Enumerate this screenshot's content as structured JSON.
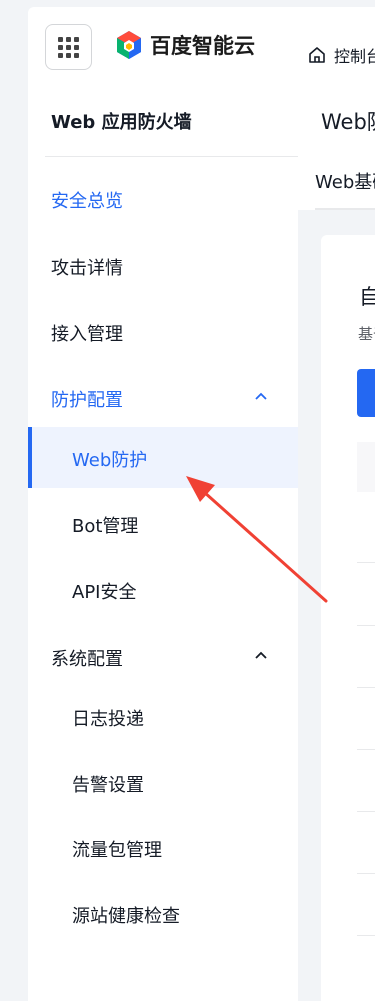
{
  "header": {
    "menu_icon": "grid-icon",
    "brand": "百度智能云",
    "console_label": "控制台",
    "home_icon": "home-icon"
  },
  "sidebar": {
    "title": "Web 应用防火墙",
    "items": [
      {
        "label": "安全总览",
        "active": true
      },
      {
        "label": "攻击详情"
      },
      {
        "label": "接入管理"
      },
      {
        "label": "防护配置",
        "expanded": true,
        "highlight": true,
        "children": [
          {
            "label": "Web防护",
            "active": true
          },
          {
            "label": "Bot管理"
          },
          {
            "label": "API安全"
          }
        ]
      },
      {
        "label": "系统配置",
        "expanded": true,
        "children": [
          {
            "label": "日志投递"
          },
          {
            "label": "告警设置"
          },
          {
            "label": "流量包管理"
          },
          {
            "label": "源站健康检查"
          }
        ]
      }
    ]
  },
  "main": {
    "title": "Web防护",
    "tab": "Web基础防护",
    "card_title": "自定义规则",
    "card_subtitle": "基于"
  },
  "annotation": {
    "arrow_color": "#f04134"
  },
  "colors": {
    "accent": "#2468f2",
    "active_bg": "#eef3fe"
  }
}
